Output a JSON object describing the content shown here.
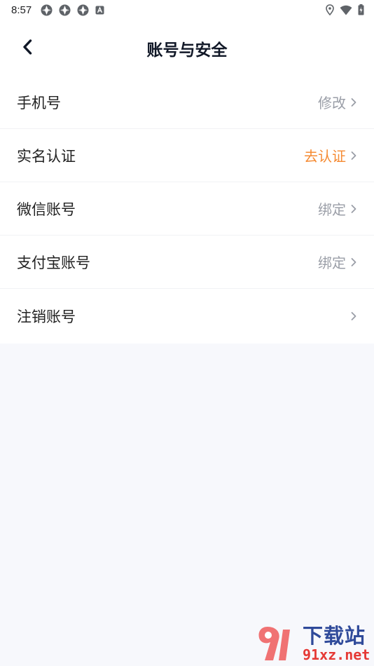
{
  "status_bar": {
    "time": "8:57",
    "left_icons": [
      "sync-icon",
      "sync-icon",
      "sync-icon",
      "accessibility-icon"
    ],
    "right_icons": [
      "location-icon",
      "wifi-icon",
      "battery-icon"
    ]
  },
  "header": {
    "back_icon": "chevron-left-icon",
    "title": "账号与安全"
  },
  "settings": {
    "items": [
      {
        "label": "手机号",
        "action": "修改"
      },
      {
        "label": "实名认证",
        "action": "去认证"
      },
      {
        "label": "微信账号",
        "action": "绑定"
      },
      {
        "label": "支付宝账号",
        "action": "绑定"
      },
      {
        "label": "注销账号",
        "action": ""
      }
    ]
  },
  "watermark": {
    "logo_text": "下载站",
    "domain": "91xz.net"
  },
  "colors": {
    "accent_orange": "#f58a32",
    "muted_gray": "#9a9ea7",
    "background": "#f7f8fc",
    "title": "#111827"
  }
}
